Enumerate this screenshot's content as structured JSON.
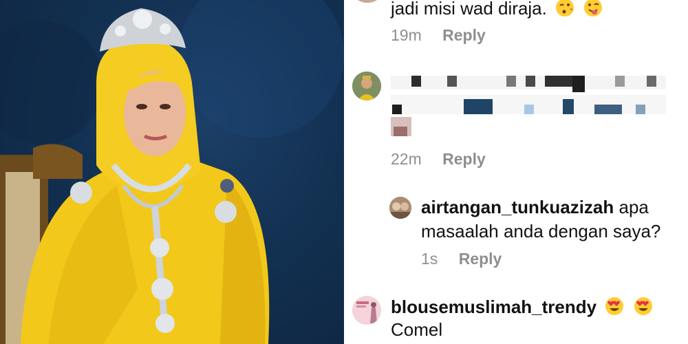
{
  "colors": {
    "photo_background": "#13304f",
    "garment_yellow": "#f2c81a",
    "meta_gray": "#8e8e8e",
    "text": "#121212"
  },
  "photo": {
    "subject": "portrait of woman in yellow hijab with tiara and brooches"
  },
  "comments": [
    {
      "id": "c1",
      "text": "jadi misi wad diraja.",
      "emoji": [
        "kissing-face-emoji",
        "winking-tongue-emoji"
      ],
      "time": "19m",
      "reply_label": "Reply"
    },
    {
      "id": "c2",
      "censored": true,
      "time": "22m",
      "reply_label": "Reply"
    },
    {
      "id": "c3",
      "username": "airtangan_tunkuazizah",
      "text_line1": "apa",
      "text_line2": "masaalah anda dengan saya?",
      "time": "1s",
      "reply_label": "Reply"
    },
    {
      "id": "c4",
      "username": "blousemuslimah_trendy",
      "emoji": [
        "heart-eyes-emoji",
        "heart-eyes-emoji"
      ],
      "text": "Comel"
    }
  ]
}
